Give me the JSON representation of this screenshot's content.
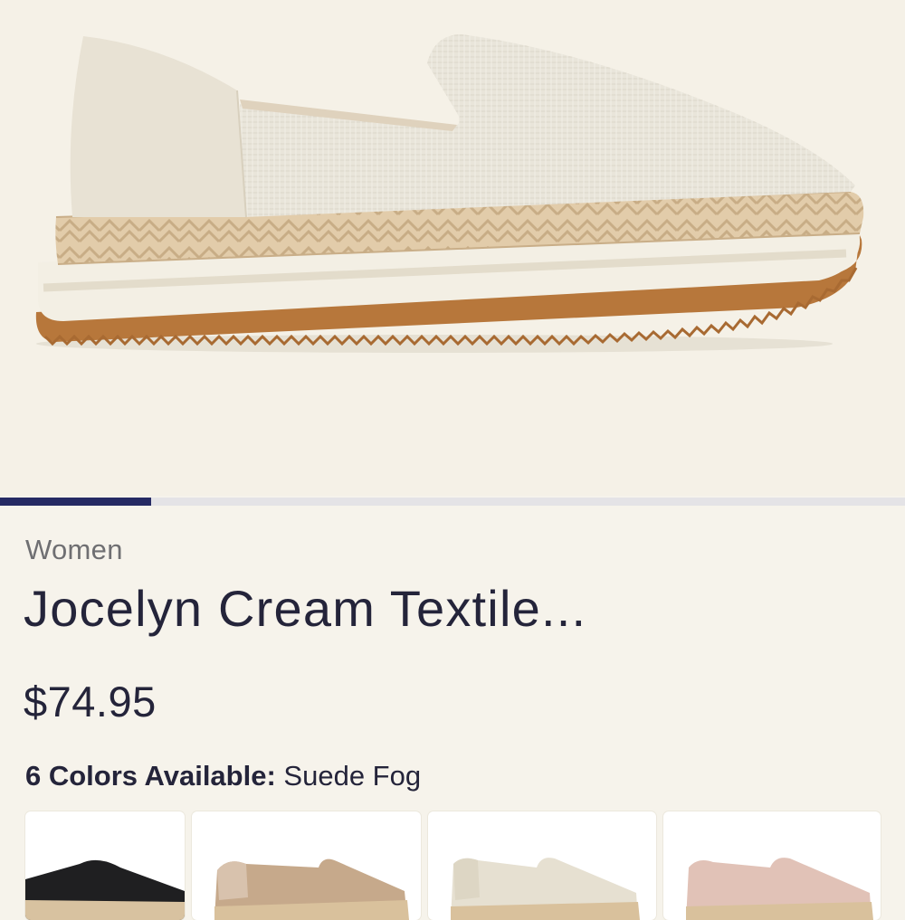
{
  "product": {
    "category": "Women",
    "title": "Jocelyn Cream Textile...",
    "price": "$74.95",
    "colors_label": "6 Colors Available:",
    "selected_color": "Suede Fog"
  },
  "gallery": {
    "progress_fraction": 0.167
  },
  "swatches": [
    {
      "color": "#1f1f21",
      "icon": "black-shoe-thumbnail"
    },
    {
      "color": "#c6a98b",
      "icon": "tan-shoe-thumbnail"
    },
    {
      "color": "#e6e0d1",
      "icon": "fog-shoe-thumbnail"
    },
    {
      "color": "#e1c2b7",
      "icon": "blush-shoe-thumbnail"
    }
  ],
  "theme": {
    "background": "#f6f3eb",
    "accent": "#252a63",
    "text": "#24243a",
    "muted_text": "#6f6f72"
  }
}
